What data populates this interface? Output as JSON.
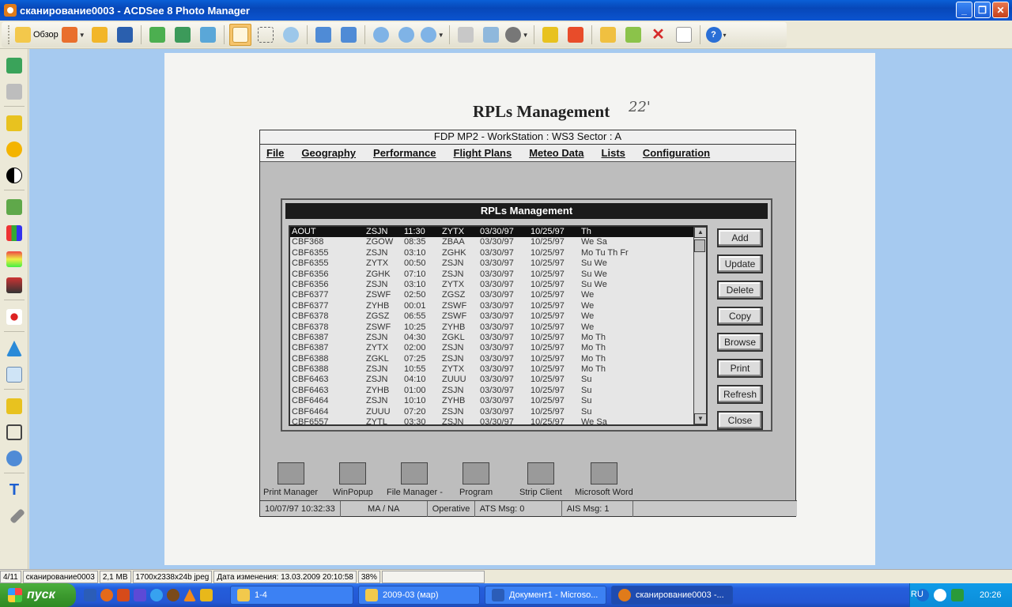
{
  "window": {
    "title": "сканирование0003 - ACDSee 8 Photo Manager",
    "minimize": "_",
    "maximize": "❐",
    "close": "✕"
  },
  "toolbar": {
    "browse_label": "Обзор"
  },
  "document": {
    "title": "RPLs Management",
    "handnote": "22'",
    "app_title": "FDP MP2 - WorkStation : WS3  Sector : A",
    "menu": [
      "File",
      "Geography",
      "Performance",
      "Flight Plans",
      "Meteo Data",
      "Lists",
      "Configuration"
    ],
    "dialog_title": "RPLs Management",
    "rows": [
      [
        "AOUT",
        "ZSJN",
        "11:30",
        "ZYTX",
        "03/30/97",
        "10/25/97",
        "Th"
      ],
      [
        "CBF368",
        "ZGOW",
        "08:35",
        "ZBAA",
        "03/30/97",
        "10/25/97",
        "We Sa"
      ],
      [
        "CBF6355",
        "ZSJN",
        "03:10",
        "ZGHK",
        "03/30/97",
        "10/25/97",
        "Mo Tu Th Fr"
      ],
      [
        "CBF6355",
        "ZYTX",
        "00:50",
        "ZSJN",
        "03/30/97",
        "10/25/97",
        "Su We"
      ],
      [
        "CBF6356",
        "ZGHK",
        "07:10",
        "ZSJN",
        "03/30/97",
        "10/25/97",
        "Su We"
      ],
      [
        "CBF6356",
        "ZSJN",
        "03:10",
        "ZYTX",
        "03/30/97",
        "10/25/97",
        "Su We"
      ],
      [
        "CBF6377",
        "ZSWF",
        "02:50",
        "ZGSZ",
        "03/30/97",
        "10/25/97",
        "We"
      ],
      [
        "CBF6377",
        "ZYHB",
        "00:01",
        "ZSWF",
        "03/30/97",
        "10/25/97",
        "We"
      ],
      [
        "CBF6378",
        "ZGSZ",
        "06:55",
        "ZSWF",
        "03/30/97",
        "10/25/97",
        "We"
      ],
      [
        "CBF6378",
        "ZSWF",
        "10:25",
        "ZYHB",
        "03/30/97",
        "10/25/97",
        "We"
      ],
      [
        "CBF6387",
        "ZSJN",
        "04:30",
        "ZGKL",
        "03/30/97",
        "10/25/97",
        "Mo Th"
      ],
      [
        "CBF6387",
        "ZYTX",
        "02:00",
        "ZSJN",
        "03/30/97",
        "10/25/97",
        "Mo Th"
      ],
      [
        "CBF6388",
        "ZGKL",
        "07:25",
        "ZSJN",
        "03/30/97",
        "10/25/97",
        "Mo Th"
      ],
      [
        "CBF6388",
        "ZSJN",
        "10:55",
        "ZYTX",
        "03/30/97",
        "10/25/97",
        "Mo Th"
      ],
      [
        "CBF6463",
        "ZSJN",
        "04:10",
        "ZUUU",
        "03/30/97",
        "10/25/97",
        "Su"
      ],
      [
        "CBF6463",
        "ZYHB",
        "01:00",
        "ZSJN",
        "03/30/97",
        "10/25/97",
        "Su"
      ],
      [
        "CBF6464",
        "ZSJN",
        "10:10",
        "ZYHB",
        "03/30/97",
        "10/25/97",
        "Su"
      ],
      [
        "CBF6464",
        "ZUUU",
        "07:20",
        "ZSJN",
        "03/30/97",
        "10/25/97",
        "Su"
      ],
      [
        "CBF6557",
        "ZYTL",
        "03:30",
        "ZSJN",
        "03/30/97",
        "10/25/97",
        "We Sa"
      ]
    ],
    "buttons": [
      "Add",
      "Update",
      "Delete",
      "Copy",
      "Browse",
      "Print",
      "Refresh",
      "Close"
    ],
    "app_icons": [
      "Print Manager",
      "WinPopup",
      "File Manager -",
      "Program",
      "Strip Client",
      "Microsoft Word"
    ],
    "status": [
      "10/07/97  10:32:33",
      "MA / NA",
      "Operative",
      "ATS Msg: 0",
      "AIS Msg: 1"
    ]
  },
  "infobar": [
    "4/11",
    "сканирование0003",
    "2,1 MB",
    "1700x2338x24b jpeg",
    "Дата изменения: 13.03.2009 20:10:58",
    "38%"
  ],
  "taskbar": {
    "start": "пуск",
    "tasks": [
      "1-4",
      "2009-03 (мар)",
      "Документ1 - Microso...",
      "сканирование0003 -..."
    ],
    "lang": "RU",
    "clock": "20:26"
  }
}
